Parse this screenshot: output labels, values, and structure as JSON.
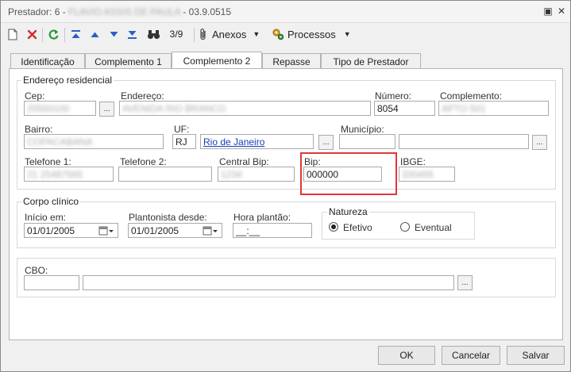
{
  "window": {
    "title_prefix": "Prestador: 6 - ",
    "title_name": "FLAVIO ASSIS DE PAULA",
    "title_suffix": " - 03.9.0515",
    "restore_glyph": "▣",
    "close_glyph": "✕"
  },
  "toolbar": {
    "record_counter": "3/9",
    "anexos_label": "Anexos",
    "processos_label": "Processos"
  },
  "tabs": [
    {
      "label": "Identificação",
      "active": false
    },
    {
      "label": "Complemento 1",
      "active": false
    },
    {
      "label": "Complemento 2",
      "active": true
    },
    {
      "label": "Repasse",
      "active": false
    },
    {
      "label": "Tipo de Prestador",
      "active": false
    }
  ],
  "address": {
    "group_label": "Endereço residencial",
    "cep": {
      "label": "Cep:",
      "value": "20550100"
    },
    "endereco": {
      "label": "Endereço:",
      "value": "AVENIDA RIO BRANCO"
    },
    "numero": {
      "label": "Número:",
      "value": "8054"
    },
    "complemento": {
      "label": "Complemento:",
      "value": "APTO 501"
    },
    "bairro": {
      "label": "Bairro:",
      "value": "COPACABANA"
    },
    "uf": {
      "label": "UF:",
      "value": "RJ",
      "state_name": "Rio de Janeiro"
    },
    "municipio": {
      "label": "Município:",
      "value": ""
    },
    "telefone1": {
      "label": "Telefone 1:",
      "value": "21 25487565"
    },
    "telefone2": {
      "label": "Telefone 2:",
      "value": ""
    },
    "central_bip": {
      "label": "Central Bip:",
      "value": "1234"
    },
    "bip": {
      "label": "Bip:",
      "value": "000000"
    },
    "ibge": {
      "label": "IBGE:",
      "value": "330455"
    },
    "browse_label": "..."
  },
  "clinical": {
    "group_label": "Corpo clínico",
    "inicio": {
      "label": "Início em:",
      "value": "01/01/2005"
    },
    "plantonista": {
      "label": "Plantonista desde:",
      "value": "01/01/2005"
    },
    "hora": {
      "label": "Hora plantão:",
      "value": "__:__"
    },
    "natureza": {
      "label": "Natureza",
      "options": [
        {
          "label": "Efetivo",
          "selected": true
        },
        {
          "label": "Eventual",
          "selected": false
        }
      ]
    }
  },
  "cbo": {
    "label": "CBO:",
    "code": "",
    "description": "",
    "browse_label": "..."
  },
  "buttons": {
    "ok": "OK",
    "cancel": "Cancelar",
    "save": "Salvar"
  },
  "colors": {
    "highlight_border": "#e03838",
    "link": "#1a3fb5",
    "toolbar_blue": "#2b5fc7",
    "delete_red": "#d42b2b",
    "refresh_green": "#2a9a3a"
  }
}
